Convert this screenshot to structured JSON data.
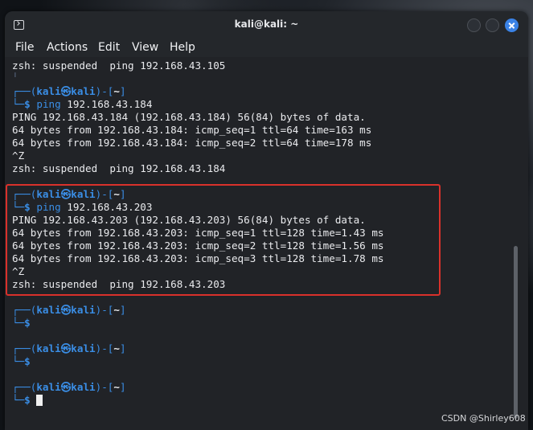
{
  "window": {
    "title": "kali@kali: ~"
  },
  "menu": [
    "File",
    "Actions",
    "Edit",
    "View",
    "Help"
  ],
  "prompt": {
    "user": "kali",
    "at": "㉿",
    "host": "kali",
    "dir": "~",
    "open": "┌──(",
    "close": ")-[",
    "close2": "]",
    "arrow": "└─",
    "dollar": "$"
  },
  "terminal": {
    "line0": "zsh: suspended  ping 192.168.43.105",
    "line1_partial": "─$ ",
    "cmd_184": "ping",
    "cmd_184_arg": " 192.168.43.184",
    "out_184": [
      "PING 192.168.43.184 (192.168.43.184) 56(84) bytes of data.",
      "64 bytes from 192.168.43.184: icmp_seq=1 ttl=64 time=163 ms",
      "64 bytes from 192.168.43.184: icmp_seq=2 ttl=64 time=178 ms",
      "^Z",
      "zsh: suspended  ping 192.168.43.184"
    ],
    "cmd_203": "ping",
    "cmd_203_arg": " 192.168.43.203",
    "out_203": [
      "PING 192.168.43.203 (192.168.43.203) 56(84) bytes of data.",
      "64 bytes from 192.168.43.203: icmp_seq=1 ttl=128 time=1.43 ms",
      "64 bytes from 192.168.43.203: icmp_seq=2 ttl=128 time=1.56 ms",
      "64 bytes from 192.168.43.203: icmp_seq=3 ttl=128 time=1.78 ms",
      "^Z",
      "zsh: suspended  ping 192.168.43.203"
    ]
  },
  "watermark": "CSDN @Shirley608",
  "colors": {
    "prompt_blue": "#3a8ee6",
    "highlight_red": "#d9312b",
    "terminal_bg": "#212327"
  }
}
